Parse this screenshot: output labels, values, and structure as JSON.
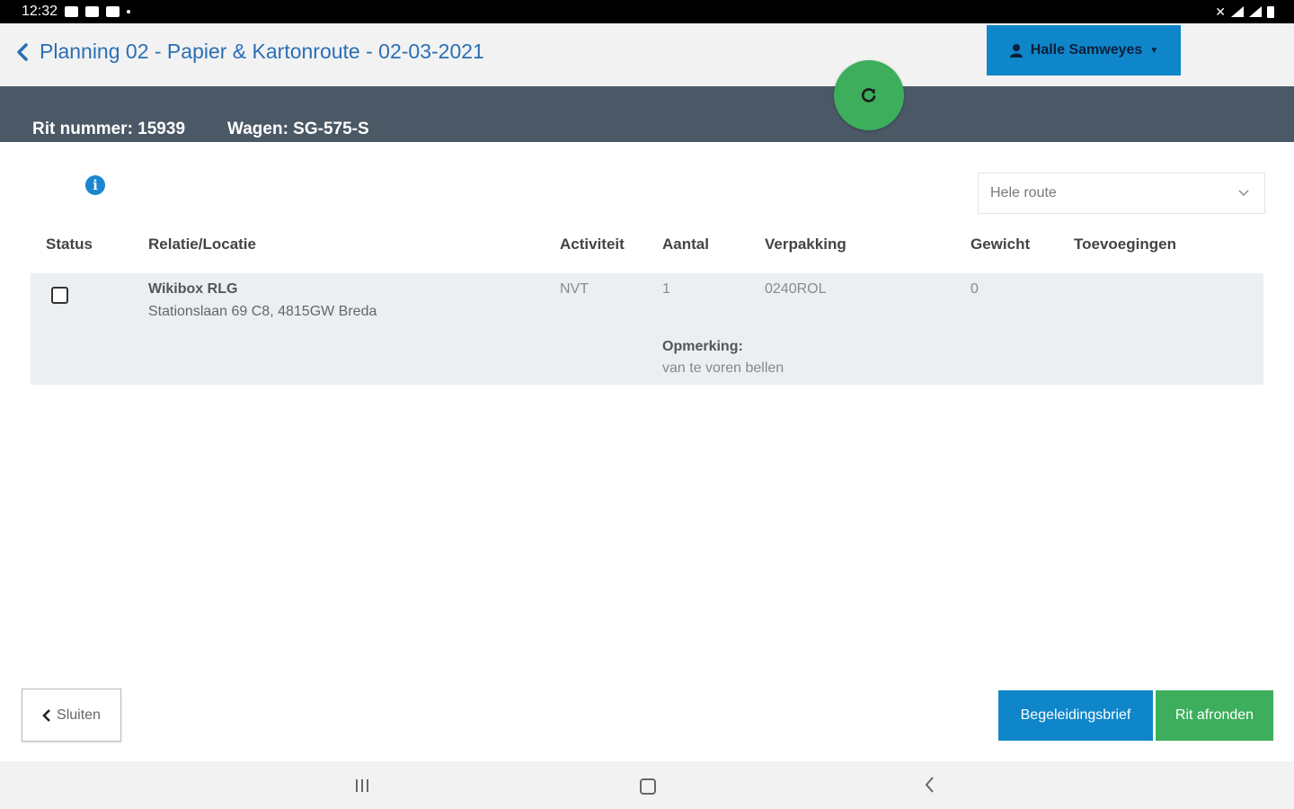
{
  "status_bar": {
    "time": "12:32"
  },
  "header": {
    "title": "Planning 02 - Papier & Kartonroute - 02-03-2021",
    "user_name": "Halle Samweyes"
  },
  "info_bar": {
    "rit_label": "Rit nummer: 15939",
    "wagen_label": "Wagen: SG-575-S"
  },
  "filter": {
    "selected": "Hele route"
  },
  "table": {
    "columns": [
      "Status",
      "Relatie/Locatie",
      "Activiteit",
      "Aantal",
      "Verpakking",
      "Gewicht",
      "Toevoegingen"
    ],
    "rows": [
      {
        "checked": false,
        "relatie_name": "Wikibox RLG",
        "relatie_address": "Stationslaan 69 C8, 4815GW Breda",
        "activiteit": "NVT",
        "aantal": "1",
        "verpakking": "0240ROL",
        "gewicht": "0",
        "toevoegingen": "",
        "opmerking_label": "Opmerking:",
        "opmerking_text": "van te voren bellen"
      }
    ]
  },
  "footer": {
    "sluiten_label": "Sluiten",
    "begeleidingsbrief_label": "Begeleidingsbrief",
    "rit_afronden_label": "Rit afronden"
  },
  "colors": {
    "primary_blue": "#0f86c9",
    "success_green": "#3cae5c",
    "info_bar_bg": "#4b5866",
    "title_blue": "#2a6fb5"
  },
  "icons": [
    "back-chevron-icon",
    "user-icon",
    "refresh-icon",
    "info-icon",
    "chevron-down-icon"
  ]
}
